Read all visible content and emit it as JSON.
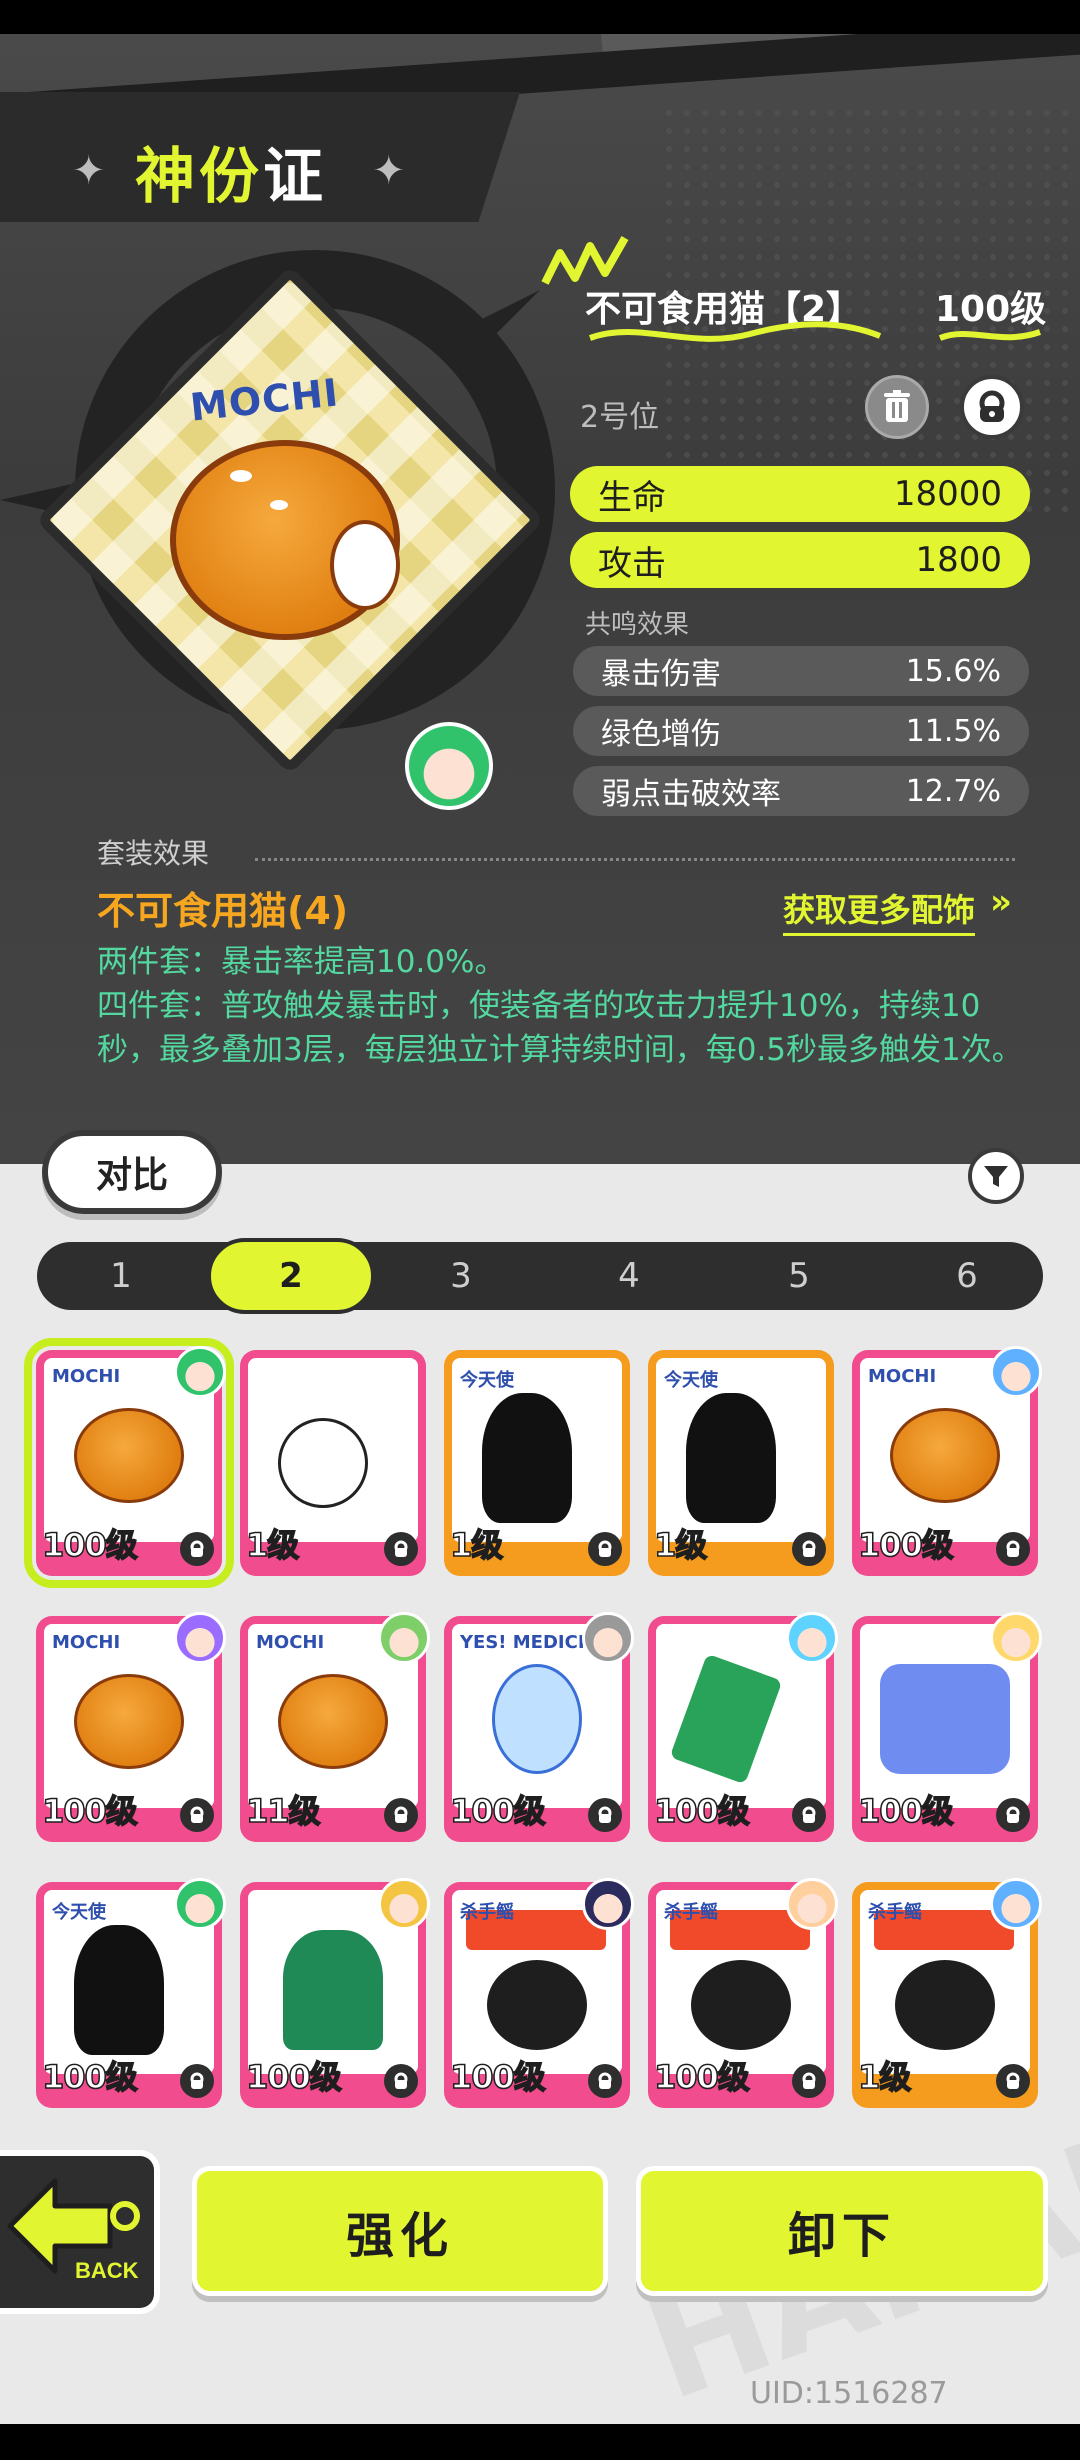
{
  "header": {
    "title_part1": "神份",
    "title_part2": "证"
  },
  "equip": {
    "name": "不可食用猫【2】",
    "level": "100级",
    "slot": "2号位",
    "art_label": "MOCHI",
    "main_stats": [
      {
        "label": "生命",
        "value": "18000"
      },
      {
        "label": "攻击",
        "value": "1800"
      }
    ],
    "resonance_label": "共鸣效果",
    "sub_stats": [
      {
        "label": "暴击伤害",
        "value": "15.6%"
      },
      {
        "label": "绿色增伤",
        "value": "11.5%"
      },
      {
        "label": "弱点击破效率",
        "value": "12.7%"
      }
    ]
  },
  "set": {
    "label": "套装效果",
    "name": "不可食用猫(4)",
    "more_link": "获取更多配饰",
    "more_arrow": "»",
    "two_piece": "两件套：暴击率提高10.0%。",
    "four_piece": "四件套：普攻触发暴击时，使装备者的攻击力提升10%，持续10秒，最多叠加3层，每层独立计算持续时间，每0.5秒最多触发1次。"
  },
  "compare_label": "对比",
  "tabs": [
    "1",
    "2",
    "3",
    "4",
    "5",
    "6"
  ],
  "active_tab": "2",
  "inventory": [
    {
      "level": "100级",
      "frame": "pink",
      "art": "cat",
      "label": "MOCHI",
      "selected": true
    },
    {
      "level": "1级",
      "frame": "pink",
      "art": "zzz"
    },
    {
      "level": "1级",
      "frame": "orange",
      "art": "shadow",
      "label": "今天使"
    },
    {
      "level": "1级",
      "frame": "orange",
      "art": "shadow",
      "label": "今天使"
    },
    {
      "level": "100级",
      "frame": "pink",
      "art": "cat",
      "label": "MOCHI"
    },
    {
      "level": "100级",
      "frame": "pink",
      "art": "cat",
      "label": "MOCHI"
    },
    {
      "level": "11级",
      "frame": "pink",
      "art": "cat",
      "label": "MOCHI"
    },
    {
      "level": "100级",
      "frame": "pink",
      "art": "bird",
      "label": "YES! MEDICINE"
    },
    {
      "level": "100级",
      "frame": "pink",
      "art": "green"
    },
    {
      "level": "100级",
      "frame": "pink",
      "art": "blue"
    },
    {
      "level": "100级",
      "frame": "pink",
      "art": "shadow",
      "label": "今天使"
    },
    {
      "level": "100级",
      "frame": "pink",
      "art": "ghost"
    },
    {
      "level": "100级",
      "frame": "pink",
      "art": "bomb",
      "label": "杀手鳐"
    },
    {
      "level": "100级",
      "frame": "pink",
      "art": "bomb",
      "label": "杀手鳐"
    },
    {
      "level": "1级",
      "frame": "orange",
      "art": "bomb",
      "label": "杀手鳐"
    }
  ],
  "back_label": "BACK",
  "buttons": {
    "upgrade": "强化",
    "unequip": "卸下"
  },
  "uid": "UID:1516287",
  "background_text": "HAKAI",
  "colors": {
    "accent": "#e2f531",
    "set_name": "#f6a61f",
    "set_desc": "#53d8a0",
    "frame_pink": "#f04c8e",
    "frame_orange": "#f59b1d"
  },
  "icons": [
    "trash-icon",
    "lock-icon",
    "filter-icon",
    "back-arrow-icon",
    "double-chevron-icon"
  ]
}
